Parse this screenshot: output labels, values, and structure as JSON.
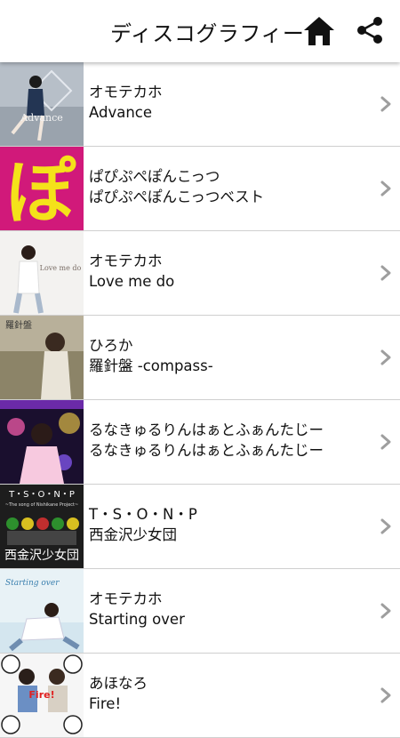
{
  "header": {
    "title": "ディスコグラフィー",
    "home_icon": "home-icon",
    "share_icon": "share-icon"
  },
  "items": [
    {
      "artist": "オモテカホ",
      "title": "Advance",
      "cover_text": "Advance"
    },
    {
      "artist": "ぱぴぷぺぽんこっつ",
      "title": "ぱぴぷぺぽんこっつベスト",
      "cover_text": "ぽ"
    },
    {
      "artist": "オモテカホ",
      "title": "Love me do",
      "cover_text": "Love me do"
    },
    {
      "artist": "ひろか",
      "title": "羅針盤 -compass-",
      "cover_text": "羅針盤"
    },
    {
      "artist": "るなきゅるりんはぁとふぁんたじー",
      "title": "るなきゅるりんはぁとふぁんたじー",
      "cover_text": ""
    },
    {
      "artist": "T・S・O・N・P",
      "title": "西金沢少女団",
      "cover_text": "T・S・O・N・P",
      "cover_text2": "~The song of Nishikane Project~",
      "cover_text3": "西金沢少女団"
    },
    {
      "artist": "オモテカホ",
      "title": "Starting over",
      "cover_text": "Starting over"
    },
    {
      "artist": "あほなろ",
      "title": "Fire!",
      "cover_text": "Fire!"
    }
  ],
  "colors": {
    "chevron": "#9e9e9e",
    "divider": "#cfcfcf",
    "icon": "#111111"
  }
}
